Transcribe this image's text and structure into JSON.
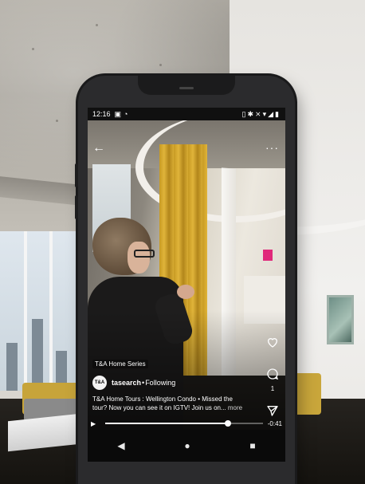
{
  "status_bar": {
    "time": "12:16",
    "icons": [
      "image-icon",
      "messenger-icon",
      "vibrate-icon",
      "bluetooth-icon",
      "mute-icon",
      "wifi-icon",
      "signal-icon",
      "battery-icon"
    ]
  },
  "video": {
    "series_tag": "T&A Home Series",
    "progress_fraction": 0.78,
    "remaining_time": "-0:41"
  },
  "profile": {
    "avatar_text": "T&A",
    "username": "tasearch",
    "separator": " • ",
    "follow_status": "Following"
  },
  "caption": {
    "text": "T&A Home Tours : Wellington Condo • Missed the tour? Now you can see it on IGTV! Join us on...",
    "more_label": " more"
  },
  "actions": {
    "comment_count": "1"
  },
  "colors": {
    "curtain": "#d8ac33",
    "accent_pink": "#e0287a"
  }
}
